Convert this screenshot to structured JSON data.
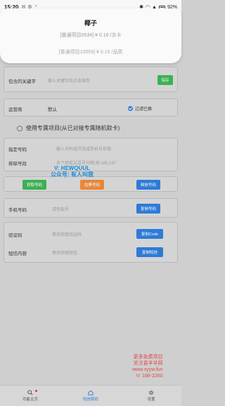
{
  "status": {
    "time": "15:20",
    "battery": "92%"
  },
  "dialog": {
    "title": "椰子",
    "line1": "[普通项目0534] ¥ 0.16 /次卡",
    "line2": "[普通项目10059] ¥ 0.16 /品质"
  },
  "keyword": {
    "label": "包含的关键字",
    "placeholder": "输入关键字后点击保存",
    "save": "保存"
  },
  "operator": {
    "label": "运营商",
    "value": "默认",
    "filter_label": "过滤已换",
    "filter_checked": true
  },
  "exclusive": {
    "label": "使用专属项目(从已对接专属随机取卡)"
  },
  "numbers": {
    "assign_label": "指定号码",
    "assign_placeholder": "输入号码或号段或手机号前缀",
    "exclude_label": "排除号段",
    "exclude_placeholder": "多个用英文逗号分隔,例:165,167"
  },
  "actions": {
    "get": "获取号码",
    "release": "拉黑号码",
    "release2": "释放号码"
  },
  "phone": {
    "label": "手机号码",
    "placeholder": "请先取号",
    "copy": "复制号码"
  },
  "verify": {
    "code_label": "验证码",
    "code_placeholder": "等待获取验证码",
    "copy_code": "复制Code",
    "msg_label": "短信内容",
    "msg_placeholder": "等待获取短信",
    "copy_msg": "复制短信"
  },
  "watermark": {
    "line1": "V: HEWQUUL",
    "line2": "公众号: 有人叫我"
  },
  "corner_watermark": {
    "line1": "更多免费项目",
    "line2": "关注喜羊羊网",
    "line3": "www.xyyw.fun",
    "line4": "V: 188-2260"
  },
  "nav": {
    "home": "功能主页",
    "current": "短信取码",
    "settings": "设置"
  }
}
